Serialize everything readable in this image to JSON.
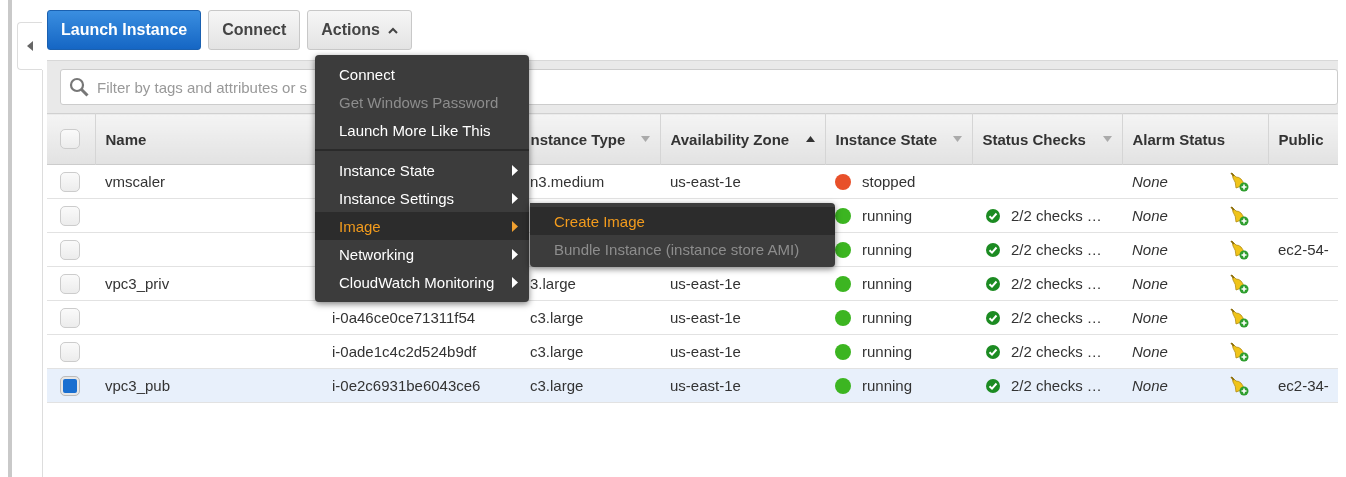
{
  "toolbar": {
    "buttons": [
      {
        "label": "Launch Instance",
        "kind": "primary"
      },
      {
        "label": "Connect",
        "kind": "default"
      },
      {
        "label": "Actions",
        "kind": "dropdown",
        "expanded": true
      }
    ]
  },
  "filter": {
    "placeholder": "Filter by tags and attributes or s"
  },
  "table": {
    "select_all": {
      "checked": false
    },
    "columns": [
      {
        "label": "Name",
        "kind": "plain"
      },
      {
        "label": "nstance Type",
        "kind": "sortable"
      },
      {
        "label": "Availability Zone",
        "kind": "sorted"
      },
      {
        "label": "Instance State",
        "kind": "sortable"
      },
      {
        "label": "Status Checks",
        "kind": "sortable"
      },
      {
        "label": "Alarm Status",
        "kind": "plain"
      },
      {
        "label": "Public",
        "kind": "plain"
      }
    ],
    "rows": [
      {
        "selected": false,
        "name": "vmscaler",
        "instance_type": "n3.medium",
        "zone": "us-east-1e",
        "state": "stopped",
        "color": "#e8502a",
        "alarm": "None"
      },
      {
        "selected": false,
        "state": "running",
        "color": "#3cb521",
        "status_checks": "2/2 checks …",
        "alarm": "None"
      },
      {
        "selected": false,
        "state": "running",
        "color": "#3cb521",
        "status_checks": "2/2 checks …",
        "alarm": "None",
        "public_dns": "ec2-54-"
      },
      {
        "selected": false,
        "name": "vpc3_priv",
        "instance_type": "3.large",
        "zone": "us-east-1e",
        "state": "running",
        "color": "#3cb521",
        "status_checks": "2/2 checks …",
        "alarm": "None"
      },
      {
        "selected": false,
        "instance_id": "i-0a46ce0ce71311f54",
        "instance_type": "c3.large",
        "zone": "us-east-1e",
        "state": "running",
        "color": "#3cb521",
        "status_checks": "2/2 checks …",
        "alarm": "None"
      },
      {
        "selected": false,
        "instance_id": "i-0ade1c4c2d524b9df",
        "instance_type": "c3.large",
        "zone": "us-east-1e",
        "state": "running",
        "color": "#3cb521",
        "status_checks": "2/2 checks …",
        "alarm": "None"
      },
      {
        "selected": true,
        "name": "vpc3_pub",
        "instance_id": "i-0e2c6931be6043ce6",
        "instance_type": "c3.large",
        "zone": "us-east-1e",
        "state": "running",
        "color": "#3cb521",
        "status_checks": "2/2 checks …",
        "alarm": "None",
        "public_dns": "ec2-34-"
      }
    ]
  },
  "actions_menu": {
    "groups": [
      [
        {
          "label": "Connect",
          "disabled": false,
          "submenu": false,
          "selected": false
        },
        {
          "label": "Get Windows Password",
          "disabled": true,
          "submenu": false,
          "selected": false
        },
        {
          "label": "Launch More Like This",
          "disabled": false,
          "submenu": false,
          "selected": false
        }
      ],
      [
        {
          "label": "Instance State",
          "disabled": false,
          "submenu": true,
          "selected": false
        },
        {
          "label": "Instance Settings",
          "disabled": false,
          "submenu": true,
          "selected": false
        },
        {
          "label": "Image",
          "disabled": false,
          "submenu": true,
          "selected": true
        },
        {
          "label": "Networking",
          "disabled": false,
          "submenu": true,
          "selected": false
        },
        {
          "label": "CloudWatch Monitoring",
          "disabled": false,
          "submenu": true,
          "selected": false
        }
      ]
    ]
  },
  "image_submenu": {
    "items": [
      {
        "label": "Create Image",
        "disabled": false,
        "selected": true
      },
      {
        "label": "Bundle Instance (instance store AMI)",
        "disabled": true,
        "selected": false
      }
    ]
  }
}
